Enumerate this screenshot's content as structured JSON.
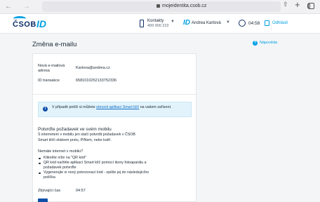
{
  "browser": {
    "url": "mojeidentita.csob.cz"
  },
  "header": {
    "logo_text": "ČSOB",
    "logo_id": "ID",
    "contacts_label": "Kontakty",
    "contacts_number": "499 900 222",
    "user_id_mark": "ID",
    "user_name": "Andrea Kartová",
    "session_timer": "04:58",
    "logout_label": "Odhlásit"
  },
  "page": {
    "title": "Změna e-mailu",
    "help_label": "Nápověda"
  },
  "details": {
    "new_email_label": "Nová e-mailová adresa",
    "new_email_value": "Kartova@andrea.cz",
    "transaction_label": "ID transakce",
    "transaction_value": "6581010252133752336"
  },
  "info": {
    "text_before": "V případě potíží si můžete ",
    "link_text": "obnovit aplikaci Smart klíč",
    "text_after": " na vašem zařízení."
  },
  "confirm": {
    "title": "Potvrďte požadavek ve svém mobilu",
    "text": "S internetem v mobilu jen stačí potvrdit požadavek v ČSOB Smart klíči otiskem prstu, PINem, nebo tváří.",
    "no_internet_title": "Nemáte internet v mobilu?",
    "steps": [
      "Klikněte níže na \"QR kód\"",
      "QR kód načtěte aplikací Smart klíč pomocí ikony fotoaparátu a požadavek potvrďte",
      "Vygenerujte si nový potvrzovací kód - opište jej do následujícího políčka"
    ],
    "remaining_label": "Zbývající čas",
    "remaining_value": "04:57"
  }
}
